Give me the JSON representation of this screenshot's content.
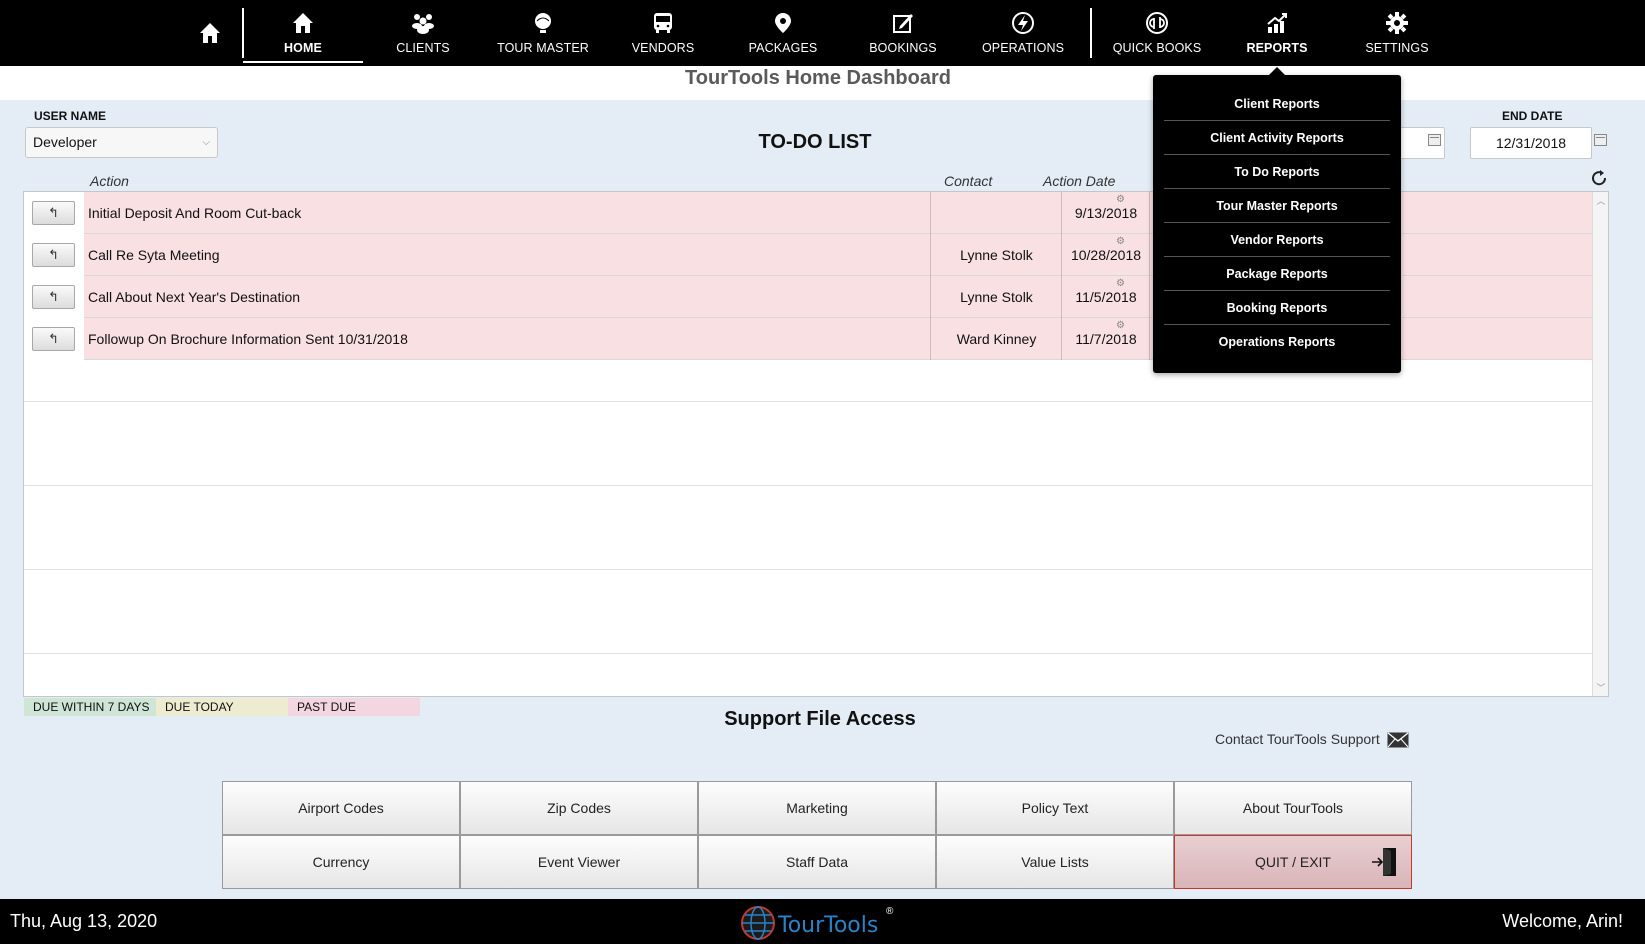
{
  "nav": {
    "items": [
      {
        "label": "HOME",
        "icon": "home-icon"
      },
      {
        "label": "CLIENTS",
        "icon": "clients-icon"
      },
      {
        "label": "TOUR MASTER",
        "icon": "globe-icon"
      },
      {
        "label": "VENDORS",
        "icon": "bus-icon"
      },
      {
        "label": "PACKAGES",
        "icon": "location-pin-icon"
      },
      {
        "label": "BOOKINGS",
        "icon": "edit-icon"
      },
      {
        "label": "OPERATIONS",
        "icon": "lightning-icon"
      },
      {
        "label": "QUICK BOOKS",
        "icon": "quickbooks-icon"
      },
      {
        "label": "REPORTS",
        "icon": "chart-icon"
      },
      {
        "label": "SETTINGS",
        "icon": "gear-icon"
      }
    ],
    "active": "HOME"
  },
  "page_title": "TourTools Home Dashboard",
  "filters": {
    "user_label": "USER NAME",
    "user_value": "Developer",
    "end_label": "END DATE",
    "end_value": "12/31/2018"
  },
  "todo": {
    "title": "TO-DO LIST",
    "columns": {
      "action": "Action",
      "contact": "Contact",
      "date": "Action Date"
    },
    "rows": [
      {
        "action": "Initial Deposit And Room Cut-back",
        "contact": "",
        "date": "9/13/2018"
      },
      {
        "action": "Call Re Syta Meeting",
        "contact": "Lynne Stolk",
        "date": "10/28/2018"
      },
      {
        "action": "Call About Next Year's Destination",
        "contact": "Lynne Stolk",
        "date": "11/5/2018"
      },
      {
        "action": "Followup On Brochure Information Sent 10/31/2018",
        "contact": "Ward Kinney",
        "date": "11/7/2018"
      }
    ]
  },
  "legend": [
    {
      "label": "DUE WITHIN 7 DAYS",
      "color": "#cfe6d6"
    },
    {
      "label": "DUE TODAY",
      "color": "#eeecd0"
    },
    {
      "label": "PAST DUE",
      "color": "#f3d6df"
    }
  ],
  "support": {
    "title": "Support File Access",
    "contact_label": "Contact TourTools Support",
    "buttons": [
      [
        "Airport Codes",
        "Zip Codes",
        "Marketing",
        "Policy Text",
        "About TourTools"
      ],
      [
        "Currency",
        "Event Viewer",
        "Staff Data",
        "Value Lists",
        "QUIT / EXIT"
      ]
    ]
  },
  "footer": {
    "date": "Thu, Aug 13, 2020",
    "welcome": "Welcome, Arin!",
    "logo_text": "TourTools",
    "logo_mark": "®"
  },
  "reports_menu": [
    "Client Reports",
    "Client Activity Reports",
    "To Do Reports",
    "Tour Master Reports",
    "Vendor Reports",
    "Package Reports",
    "Booking Reports",
    "Operations Reports"
  ]
}
